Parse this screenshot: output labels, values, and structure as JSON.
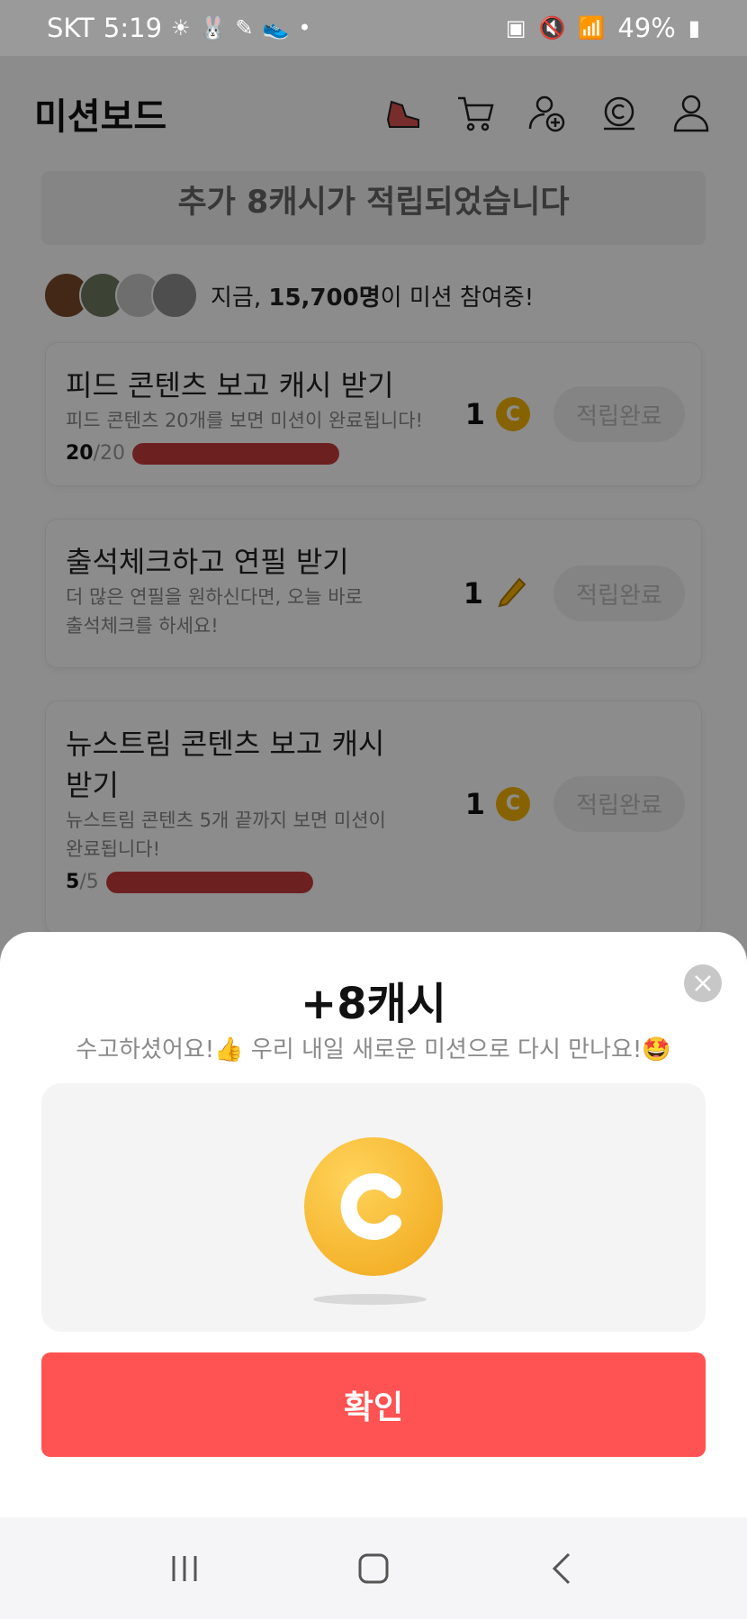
{
  "status_bar": {
    "carrier": "SKT",
    "time": "5:19",
    "battery": "49%"
  },
  "header": {
    "title": "미션보드",
    "icons": [
      "shoe-icon",
      "cart-icon",
      "add-friend-icon",
      "cash-coin-icon",
      "profile-icon"
    ]
  },
  "banner": {
    "text": "추가 8캐시가 적립되었습니다"
  },
  "participants": {
    "prefix": "지금, ",
    "count": "15,700명",
    "suffix": "이 미션 참여중!"
  },
  "missions": [
    {
      "title": "피드 콘텐츠 보고 캐시 받기",
      "desc": "피드 콘텐츠 20개를 보면 미션이 완료됩니다!",
      "progress_done": "20",
      "progress_total": "/20",
      "progress_fraction": 1.0,
      "reward": "1",
      "reward_icon": "coin-icon",
      "button": "적립완료"
    },
    {
      "title": "출석체크하고 연필 받기",
      "desc": "더 많은 연필을 원하신다면, 오늘 바로 출석체크를 하세요!",
      "reward": "1",
      "reward_icon": "pencil-icon",
      "button": "적립완료"
    },
    {
      "title": "뉴스트림 콘텐츠 보고 캐시 받기",
      "desc": "뉴스트림 콘텐츠 5개 끝까지 보면 미션이 완료됩니다!",
      "progress_done": "5",
      "progress_total": "/5",
      "progress_fraction": 1.0,
      "reward": "1",
      "reward_icon": "coin-icon",
      "button": "적립완료"
    }
  ],
  "sheet": {
    "title": "+8캐시",
    "subtitle": "수고하셨어요!👍 우리 내일 새로운 미션으로 다시 만나요!🤩",
    "confirm": "확인"
  },
  "colors": {
    "accent": "#ff5252",
    "coin": "#f4b400",
    "progress": "#c73b3b"
  }
}
